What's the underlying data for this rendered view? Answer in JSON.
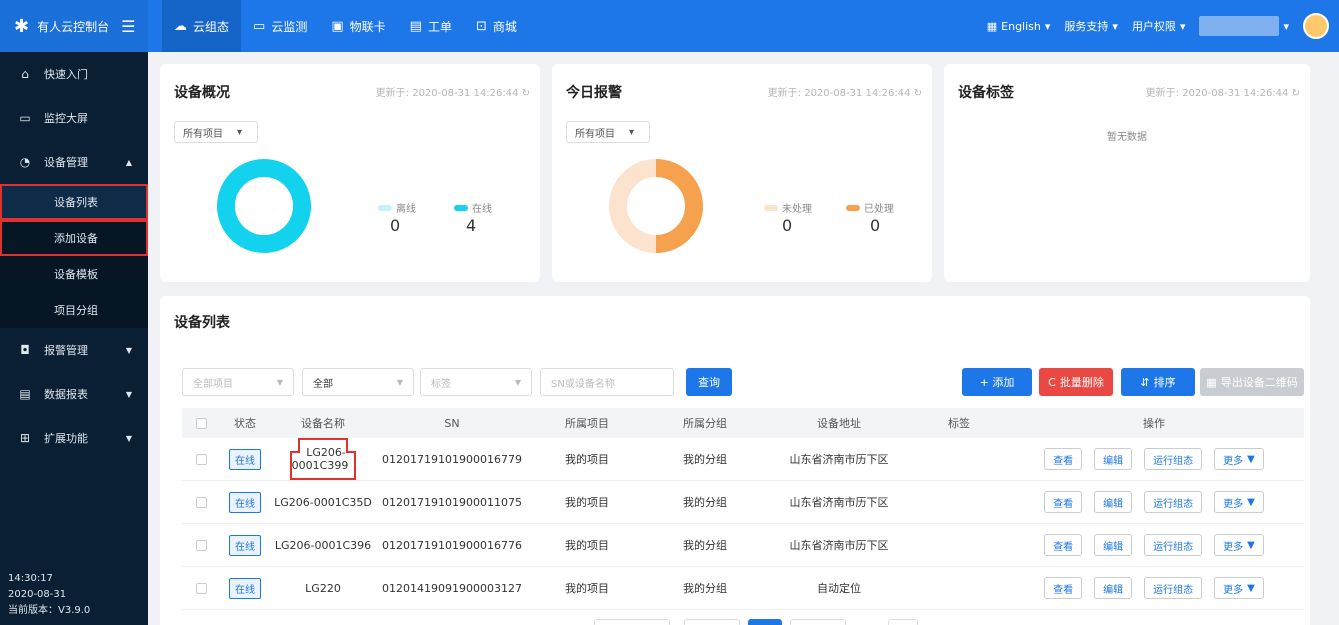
{
  "brand": {
    "title": "有人云控制台"
  },
  "topnav": [
    {
      "label": "云组态",
      "icon": "cloud-icon"
    },
    {
      "label": "云监测",
      "icon": "monitor-icon"
    },
    {
      "label": "物联卡",
      "icon": "simcard-icon"
    },
    {
      "label": "工单",
      "icon": "ticket-icon"
    },
    {
      "label": "商城",
      "icon": "shop-icon"
    }
  ],
  "topright": {
    "language": "English",
    "support": "服务支持",
    "permission": "用户权限"
  },
  "sidebar": {
    "items": [
      {
        "label": "快速入门",
        "icon": "home-icon"
      },
      {
        "label": "监控大屏",
        "icon": "screen-icon"
      },
      {
        "label": "设备管理",
        "icon": "device-icon"
      }
    ],
    "subitems": [
      {
        "label": "设备列表"
      },
      {
        "label": "添加设备"
      },
      {
        "label": "设备模板"
      },
      {
        "label": "项目分组"
      }
    ],
    "items2": [
      {
        "label": "报警管理",
        "icon": "bell-icon"
      },
      {
        "label": "数据报表",
        "icon": "report-icon"
      },
      {
        "label": "扩展功能",
        "icon": "apps-icon"
      }
    ],
    "time": "14:30:17",
    "date": "2020-08-31",
    "version": "当前版本：V3.9.0"
  },
  "overview": {
    "title": "设备概况",
    "updated": "更新于: 2020-08-31 14:26:44",
    "select": "所有项目",
    "offline_label": "离线",
    "online_label": "在线",
    "offline": "0",
    "online": "4"
  },
  "alarm": {
    "title": "今日报警",
    "updated": "更新于: 2020-08-31 14:26:44",
    "select": "所有项目",
    "unhandled_label": "未处理",
    "handled_label": "已处理",
    "unhandled": "0",
    "handled": "0"
  },
  "tags": {
    "title": "设备标签",
    "updated": "更新于: 2020-08-31 14:26:44",
    "empty": "暂无数据"
  },
  "list": {
    "title": "设备列表",
    "filters": {
      "project": "全部项目",
      "status": "全部",
      "tag": "标签",
      "search_placeholder": "SN或设备名称"
    },
    "query": "查询",
    "add": "+ 添加",
    "batch_delete": "批量删除",
    "sort": "排序",
    "export": "导出设备二维码",
    "headers": [
      "状态",
      "设备名称",
      "SN",
      "所属项目",
      "所属分组",
      "设备地址",
      "标签",
      "操作"
    ],
    "rows": [
      {
        "state": "在线",
        "name": "LG206-0001C399",
        "sn": "01201719101900016779",
        "project": "我的项目",
        "group": "我的分组",
        "address": "山东省济南市历下区",
        "tag": ""
      },
      {
        "state": "在线",
        "name": "LG206-0001C35D",
        "sn": "01201719101900011075",
        "project": "我的项目",
        "group": "我的分组",
        "address": "山东省济南市历下区",
        "tag": ""
      },
      {
        "state": "在线",
        "name": "LG206-0001C396",
        "sn": "01201719101900016776",
        "project": "我的项目",
        "group": "我的分组",
        "address": "山东省济南市历下区",
        "tag": ""
      },
      {
        "state": "在线",
        "name": "LG220",
        "sn": "01201419091900003127",
        "project": "我的项目",
        "group": "我的分组",
        "address": "自动定位",
        "tag": ""
      }
    ],
    "ops": {
      "view": "查看",
      "edit": "编辑",
      "run": "运行组态",
      "more": "更多"
    }
  },
  "colors": {
    "primary": "#1e77e8",
    "sidebar": "#0a1f33",
    "cyan": "#13d2ee",
    "orange": "#f5a14e",
    "danger": "#e94843"
  }
}
